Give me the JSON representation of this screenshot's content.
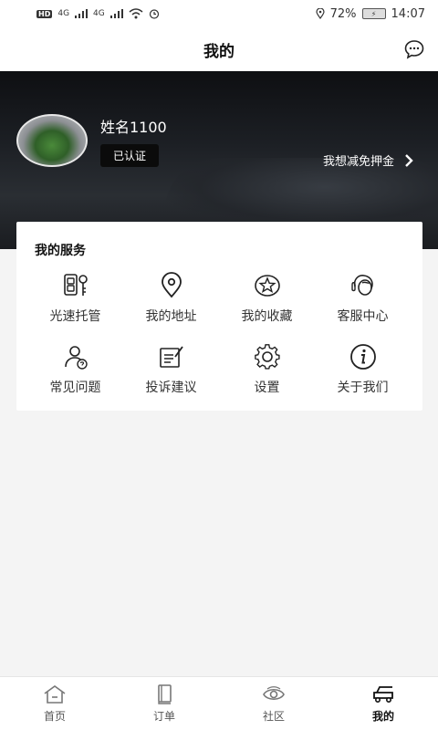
{
  "status_bar": {
    "hd": "HD",
    "net1": "4G",
    "net2": "4G",
    "battery_pct": "72%",
    "time": "14:07"
  },
  "header": {
    "title": "我的"
  },
  "profile": {
    "name": "姓名1100",
    "badge": "已认证",
    "deposit_link": "我想减免押金"
  },
  "services": {
    "title": "我的服务",
    "items": [
      {
        "label": "光速托管",
        "icon": "key-fob-icon"
      },
      {
        "label": "我的地址",
        "icon": "location-pin-icon"
      },
      {
        "label": "我的收藏",
        "icon": "star-icon"
      },
      {
        "label": "客服中心",
        "icon": "customer-service-icon"
      },
      {
        "label": "常见问题",
        "icon": "faq-person-icon"
      },
      {
        "label": "投诉建议",
        "icon": "feedback-edit-icon"
      },
      {
        "label": "设置",
        "icon": "gear-icon"
      },
      {
        "label": "关于我们",
        "icon": "info-icon"
      }
    ]
  },
  "tabs": [
    {
      "label": "首页",
      "icon": "home-icon",
      "active": false
    },
    {
      "label": "订单",
      "icon": "order-book-icon",
      "active": false
    },
    {
      "label": "社区",
      "icon": "eye-community-icon",
      "active": false
    },
    {
      "label": "我的",
      "icon": "profile-car-icon",
      "active": true
    }
  ]
}
